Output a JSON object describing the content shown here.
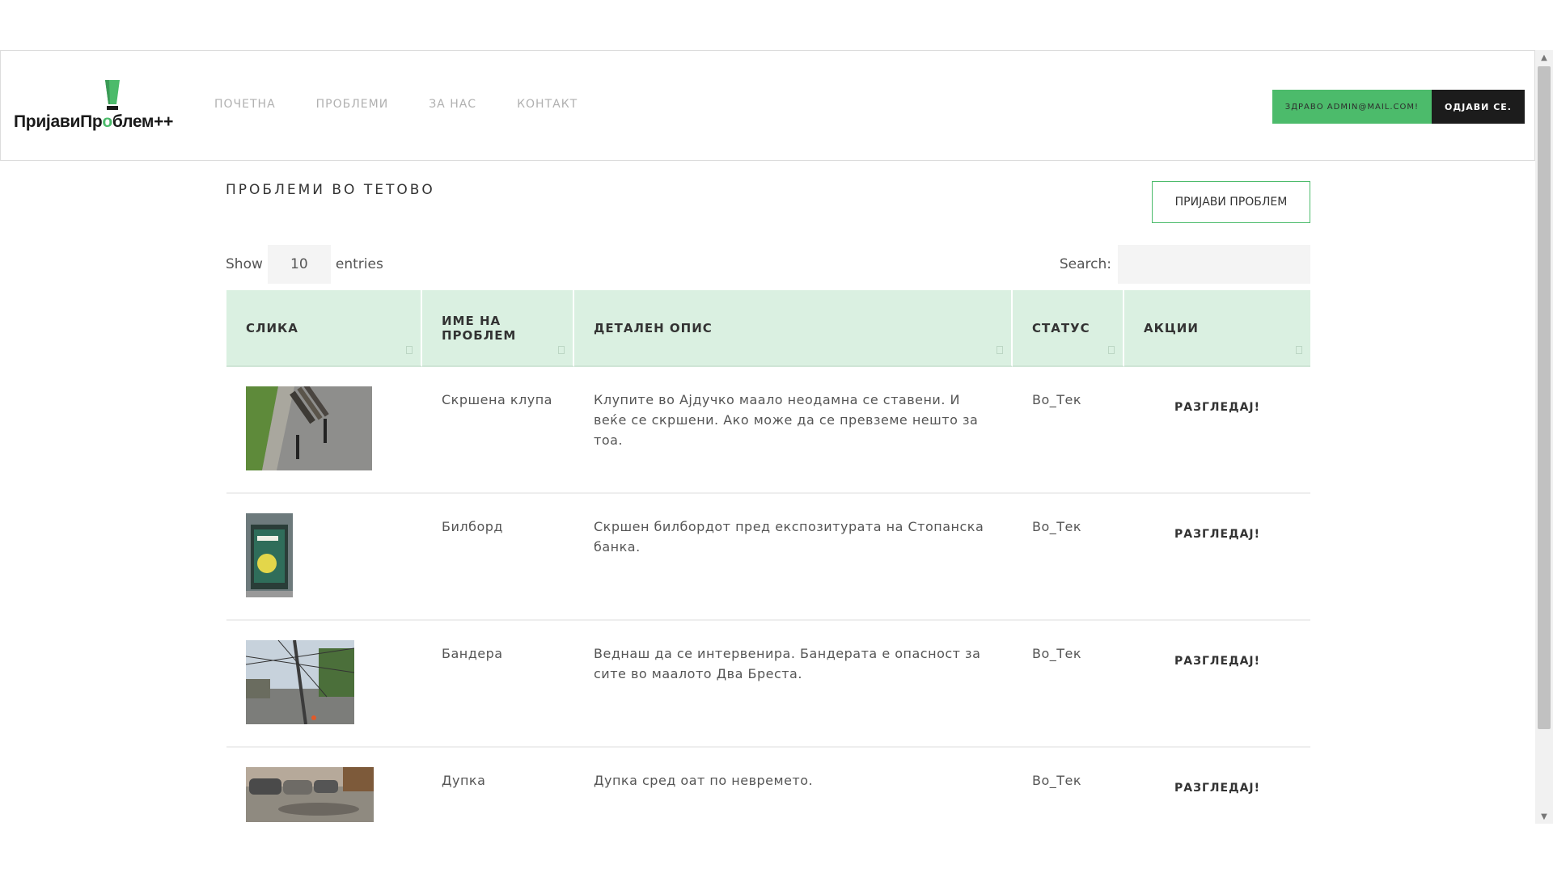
{
  "brand": {
    "name_part1": "ПријавиПр",
    "name_o": "o",
    "name_part2": "блем++",
    "accent_color": "#4cbb6b"
  },
  "nav": {
    "items": [
      {
        "label": "ПОЧЕТНА"
      },
      {
        "label": "ПРОБЛЕМИ"
      },
      {
        "label": "ЗА НАС"
      },
      {
        "label": "КОНТАКТ"
      }
    ]
  },
  "user": {
    "greeting": "ЗДРАВО ADMIN@MAIL.COM!",
    "logout_label": "ОДЈАВИ СЕ."
  },
  "page": {
    "title": "ПРОБЛЕМИ ВО ТЕТОВО",
    "report_button": "ПРИЈАВИ ПРОБЛЕМ"
  },
  "table_controls": {
    "show_label": "Show",
    "entries_value": "10",
    "entries_label": "entries",
    "search_label": "Search:",
    "search_value": ""
  },
  "table": {
    "columns": [
      {
        "label": "СЛИКА"
      },
      {
        "label": "ИМЕ НА ПРОБЛЕМ"
      },
      {
        "label": "ДЕТАЛЕН ОПИС"
      },
      {
        "label": "СТАТУС"
      },
      {
        "label": "АКЦИИ"
      }
    ],
    "rows": [
      {
        "image": "bench-photo",
        "name": "Скршена клупа",
        "description": "Клупите во Ајдучко маало неодамна се ставени. И веќе се скршени. Ако може да се превземе нешто за тоа.",
        "status": "Во_Тек",
        "action": "РАЗГЛЕДАЈ!"
      },
      {
        "image": "billboard-photo",
        "name": "Билборд",
        "description": "Скршен билбордот пред експозитурата на Стопанска банка.",
        "status": "Во_Тек",
        "action": "РАЗГЛЕДАЈ!"
      },
      {
        "image": "flag-pole-photo",
        "name": "Бандера",
        "description": "Веднаш да се интервенира. Бандерата е опасност за сите во маалото Два Бреста.",
        "status": "Во_Тек",
        "action": "РАЗГЛЕДАЈ!"
      },
      {
        "image": "pothole-photo",
        "name": "Дупка",
        "description": "Дупка сред оат по невремето.",
        "status": "Во_Тек",
        "action": "РАЗГЛЕДАЈ!"
      }
    ]
  }
}
